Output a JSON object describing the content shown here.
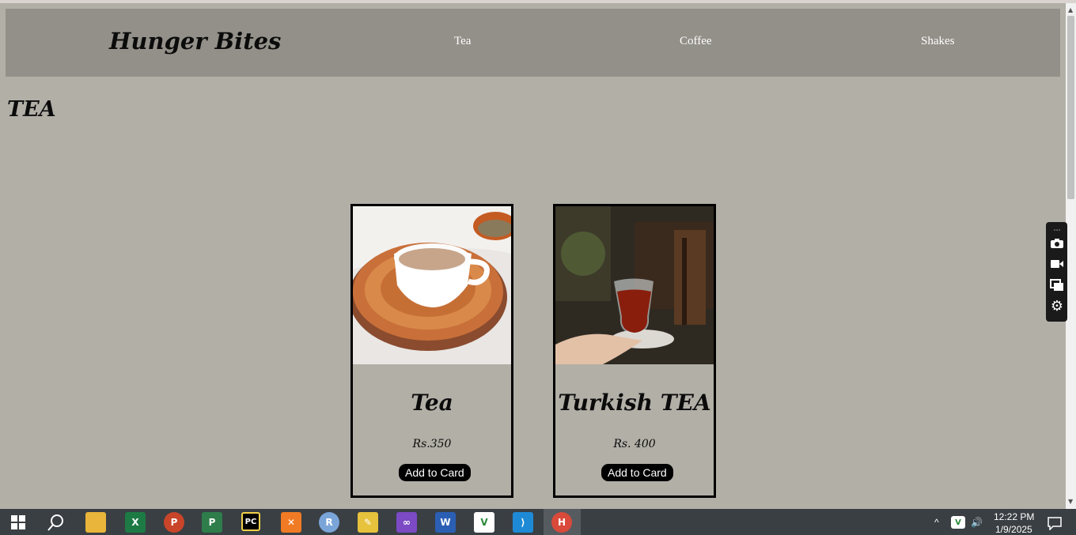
{
  "brand": "Hunger Bites",
  "nav": [
    {
      "label": "Tea"
    },
    {
      "label": "Coffee"
    },
    {
      "label": "Shakes"
    }
  ],
  "section_title": "TEA",
  "products": [
    {
      "name": "Tea",
      "price": "Rs.350",
      "button": "Add to Card"
    },
    {
      "name": "Turkish TEA",
      "price": "Rs. 400",
      "button": "Add to Card"
    }
  ],
  "taskbar": {
    "time": "12:22 PM",
    "date": "1/9/2025",
    "apps": [
      "windows-start",
      "search",
      "file-explorer",
      "excel",
      "powerpoint",
      "project",
      "pycharm",
      "xampp",
      "r",
      "sketch-tool",
      "visual-studio",
      "word",
      "vs-tool",
      "vscode",
      "chrome"
    ]
  },
  "colors": {
    "page_bg": "#b2afa7",
    "navbar_bg": "#939089",
    "taskbar_bg": "#3a3f43"
  }
}
